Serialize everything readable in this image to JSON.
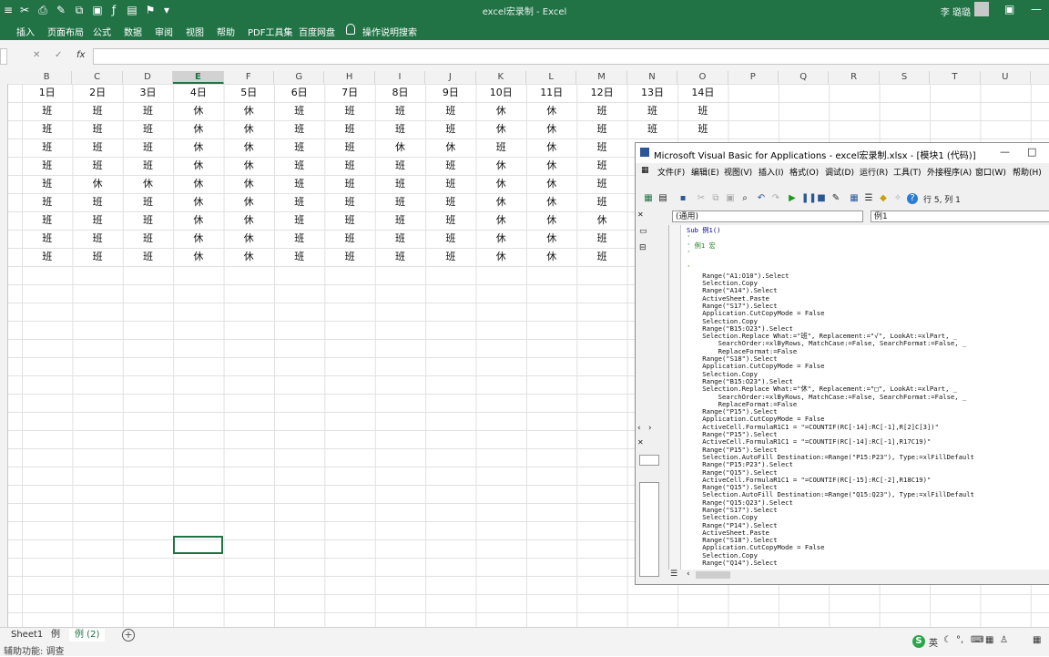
{
  "window": {
    "title": "excel宏录制 - Excel",
    "user": "李 璐璐"
  },
  "ribbon": {
    "tabs": [
      "插入",
      "页面布局",
      "公式",
      "数据",
      "审阅",
      "视图",
      "帮助",
      "PDF工具集",
      "百度网盘"
    ],
    "search": "操作说明搜索"
  },
  "formula_bar": {
    "cancel": "✕",
    "enter": "✓",
    "fx": "fx"
  },
  "columns": [
    "B",
    "C",
    "D",
    "E",
    "F",
    "G",
    "H",
    "I",
    "J",
    "K",
    "L",
    "M",
    "N",
    "O",
    "P",
    "Q",
    "R",
    "S",
    "T",
    "U"
  ],
  "selected_column": "E",
  "header_row": [
    "1日",
    "2日",
    "3日",
    "4日",
    "5日",
    "6日",
    "7日",
    "8日",
    "9日",
    "10日",
    "11日",
    "12日",
    "13日",
    "14日"
  ],
  "rows": [
    [
      "班",
      "班",
      "班",
      "休",
      "休",
      "班",
      "班",
      "班",
      "班",
      "休",
      "休",
      "班",
      "班",
      "班"
    ],
    [
      "班",
      "班",
      "班",
      "休",
      "休",
      "班",
      "班",
      "班",
      "班",
      "休",
      "休",
      "班",
      "班",
      "班"
    ],
    [
      "班",
      "班",
      "班",
      "休",
      "休",
      "班",
      "班",
      "休",
      "休",
      "班",
      "休",
      "班",
      "",
      ""
    ],
    [
      "班",
      "班",
      "班",
      "休",
      "休",
      "班",
      "班",
      "班",
      "班",
      "休",
      "休",
      "班",
      "",
      ""
    ],
    [
      "班",
      "休",
      "休",
      "休",
      "休",
      "班",
      "班",
      "班",
      "班",
      "休",
      "休",
      "班",
      "",
      ""
    ],
    [
      "班",
      "班",
      "班",
      "休",
      "休",
      "班",
      "班",
      "班",
      "班",
      "休",
      "休",
      "班",
      "",
      ""
    ],
    [
      "班",
      "班",
      "班",
      "休",
      "休",
      "班",
      "班",
      "班",
      "班",
      "休",
      "休",
      "休",
      "",
      ""
    ],
    [
      "班",
      "班",
      "班",
      "休",
      "休",
      "班",
      "班",
      "班",
      "班",
      "休",
      "休",
      "班",
      "",
      ""
    ],
    [
      "班",
      "班",
      "班",
      "休",
      "休",
      "班",
      "班",
      "班",
      "班",
      "休",
      "休",
      "班",
      "",
      ""
    ]
  ],
  "sheets": [
    "Sheet1",
    "例",
    "例 (2)"
  ],
  "active_sheet": "例 (2)",
  "status": "辅助功能: 调查",
  "vba": {
    "title": "Microsoft Visual Basic for Applications - excel宏录制.xlsx - [模块1 (代码)]",
    "menu": [
      "文件(F)",
      "编辑(E)",
      "视图(V)",
      "插入(I)",
      "格式(O)",
      "调试(D)",
      "运行(R)",
      "工具(T)",
      "外接程序(A)",
      "窗口(W)",
      "帮助(H)"
    ],
    "line_info": "行 5, 列 1",
    "object_dropdown": "(通用)",
    "proc_dropdown": "例1",
    "code": [
      "Sub 例1()",
      "'",
      "' 例1 宏",
      "'",
      "",
      "'",
      "    Range(\"A1:O10\").Select",
      "    Selection.Copy",
      "    Range(\"A14\").Select",
      "    ActiveSheet.Paste",
      "    Range(\"S17\").Select",
      "    Application.CutCopyMode = False",
      "    Selection.Copy",
      "    Range(\"B15:O23\").Select",
      "    Selection.Replace What:=\"班\", Replacement:=\"√\", LookAt:=xlPart, _",
      "        SearchOrder:=xlByRows, MatchCase:=False, SearchFormat:=False, _",
      "        ReplaceFormat:=False",
      "    Range(\"S18\").Select",
      "    Application.CutCopyMode = False",
      "    Selection.Copy",
      "    Range(\"B15:O23\").Select",
      "    Selection.Replace What:=\"休\", Replacement:=\"□\", LookAt:=xlPart, _",
      "        SearchOrder:=xlByRows, MatchCase:=False, SearchFormat:=False, _",
      "        ReplaceFormat:=False",
      "    Range(\"P15\").Select",
      "    Application.CutCopyMode = False",
      "    ActiveCell.FormulaR1C1 = \"=COUNTIF(RC[-14]:RC[-1],R[2]C[3])\"",
      "    Range(\"P15\").Select",
      "    ActiveCell.FormulaR1C1 = \"=COUNTIF(RC[-14]:RC[-1],R17C19)\"",
      "    Range(\"P15\").Select",
      "    Selection.AutoFill Destination:=Range(\"P15:P23\"), Type:=xlFillDefault",
      "    Range(\"P15:P23\").Select",
      "    Range(\"Q15\").Select",
      "    ActiveCell.FormulaR1C1 = \"=COUNTIF(RC[-15]:RC[-2],R18C19)\"",
      "    Range(\"Q15\").Select",
      "    Selection.AutoFill Destination:=Range(\"Q15:Q23\"), Type:=xlFillDefault",
      "    Range(\"Q15:Q23\").Select",
      "    Range(\"S17\").Select",
      "    Selection.Copy",
      "    Range(\"P14\").Select",
      "    ActiveSheet.Paste",
      "    Range(\"S18\").Select",
      "    Application.CutCopyMode = False",
      "    Selection.Copy",
      "    Range(\"Q14\").Select"
    ]
  },
  "tray": {
    "ime": "英"
  }
}
